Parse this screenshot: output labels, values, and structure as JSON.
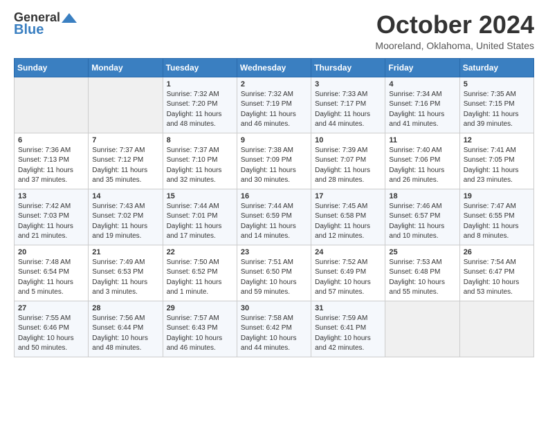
{
  "header": {
    "logo_general": "General",
    "logo_blue": "Blue",
    "month_title": "October 2024",
    "location": "Mooreland, Oklahoma, United States"
  },
  "days_of_week": [
    "Sunday",
    "Monday",
    "Tuesday",
    "Wednesday",
    "Thursday",
    "Friday",
    "Saturday"
  ],
  "weeks": [
    [
      {
        "day": "",
        "info": ""
      },
      {
        "day": "",
        "info": ""
      },
      {
        "day": "1",
        "info": "Sunrise: 7:32 AM\nSunset: 7:20 PM\nDaylight: 11 hours and 48 minutes."
      },
      {
        "day": "2",
        "info": "Sunrise: 7:32 AM\nSunset: 7:19 PM\nDaylight: 11 hours and 46 minutes."
      },
      {
        "day": "3",
        "info": "Sunrise: 7:33 AM\nSunset: 7:17 PM\nDaylight: 11 hours and 44 minutes."
      },
      {
        "day": "4",
        "info": "Sunrise: 7:34 AM\nSunset: 7:16 PM\nDaylight: 11 hours and 41 minutes."
      },
      {
        "day": "5",
        "info": "Sunrise: 7:35 AM\nSunset: 7:15 PM\nDaylight: 11 hours and 39 minutes."
      }
    ],
    [
      {
        "day": "6",
        "info": "Sunrise: 7:36 AM\nSunset: 7:13 PM\nDaylight: 11 hours and 37 minutes."
      },
      {
        "day": "7",
        "info": "Sunrise: 7:37 AM\nSunset: 7:12 PM\nDaylight: 11 hours and 35 minutes."
      },
      {
        "day": "8",
        "info": "Sunrise: 7:37 AM\nSunset: 7:10 PM\nDaylight: 11 hours and 32 minutes."
      },
      {
        "day": "9",
        "info": "Sunrise: 7:38 AM\nSunset: 7:09 PM\nDaylight: 11 hours and 30 minutes."
      },
      {
        "day": "10",
        "info": "Sunrise: 7:39 AM\nSunset: 7:07 PM\nDaylight: 11 hours and 28 minutes."
      },
      {
        "day": "11",
        "info": "Sunrise: 7:40 AM\nSunset: 7:06 PM\nDaylight: 11 hours and 26 minutes."
      },
      {
        "day": "12",
        "info": "Sunrise: 7:41 AM\nSunset: 7:05 PM\nDaylight: 11 hours and 23 minutes."
      }
    ],
    [
      {
        "day": "13",
        "info": "Sunrise: 7:42 AM\nSunset: 7:03 PM\nDaylight: 11 hours and 21 minutes."
      },
      {
        "day": "14",
        "info": "Sunrise: 7:43 AM\nSunset: 7:02 PM\nDaylight: 11 hours and 19 minutes."
      },
      {
        "day": "15",
        "info": "Sunrise: 7:44 AM\nSunset: 7:01 PM\nDaylight: 11 hours and 17 minutes."
      },
      {
        "day": "16",
        "info": "Sunrise: 7:44 AM\nSunset: 6:59 PM\nDaylight: 11 hours and 14 minutes."
      },
      {
        "day": "17",
        "info": "Sunrise: 7:45 AM\nSunset: 6:58 PM\nDaylight: 11 hours and 12 minutes."
      },
      {
        "day": "18",
        "info": "Sunrise: 7:46 AM\nSunset: 6:57 PM\nDaylight: 11 hours and 10 minutes."
      },
      {
        "day": "19",
        "info": "Sunrise: 7:47 AM\nSunset: 6:55 PM\nDaylight: 11 hours and 8 minutes."
      }
    ],
    [
      {
        "day": "20",
        "info": "Sunrise: 7:48 AM\nSunset: 6:54 PM\nDaylight: 11 hours and 5 minutes."
      },
      {
        "day": "21",
        "info": "Sunrise: 7:49 AM\nSunset: 6:53 PM\nDaylight: 11 hours and 3 minutes."
      },
      {
        "day": "22",
        "info": "Sunrise: 7:50 AM\nSunset: 6:52 PM\nDaylight: 11 hours and 1 minute."
      },
      {
        "day": "23",
        "info": "Sunrise: 7:51 AM\nSunset: 6:50 PM\nDaylight: 10 hours and 59 minutes."
      },
      {
        "day": "24",
        "info": "Sunrise: 7:52 AM\nSunset: 6:49 PM\nDaylight: 10 hours and 57 minutes."
      },
      {
        "day": "25",
        "info": "Sunrise: 7:53 AM\nSunset: 6:48 PM\nDaylight: 10 hours and 55 minutes."
      },
      {
        "day": "26",
        "info": "Sunrise: 7:54 AM\nSunset: 6:47 PM\nDaylight: 10 hours and 53 minutes."
      }
    ],
    [
      {
        "day": "27",
        "info": "Sunrise: 7:55 AM\nSunset: 6:46 PM\nDaylight: 10 hours and 50 minutes."
      },
      {
        "day": "28",
        "info": "Sunrise: 7:56 AM\nSunset: 6:44 PM\nDaylight: 10 hours and 48 minutes."
      },
      {
        "day": "29",
        "info": "Sunrise: 7:57 AM\nSunset: 6:43 PM\nDaylight: 10 hours and 46 minutes."
      },
      {
        "day": "30",
        "info": "Sunrise: 7:58 AM\nSunset: 6:42 PM\nDaylight: 10 hours and 44 minutes."
      },
      {
        "day": "31",
        "info": "Sunrise: 7:59 AM\nSunset: 6:41 PM\nDaylight: 10 hours and 42 minutes."
      },
      {
        "day": "",
        "info": ""
      },
      {
        "day": "",
        "info": ""
      }
    ]
  ]
}
